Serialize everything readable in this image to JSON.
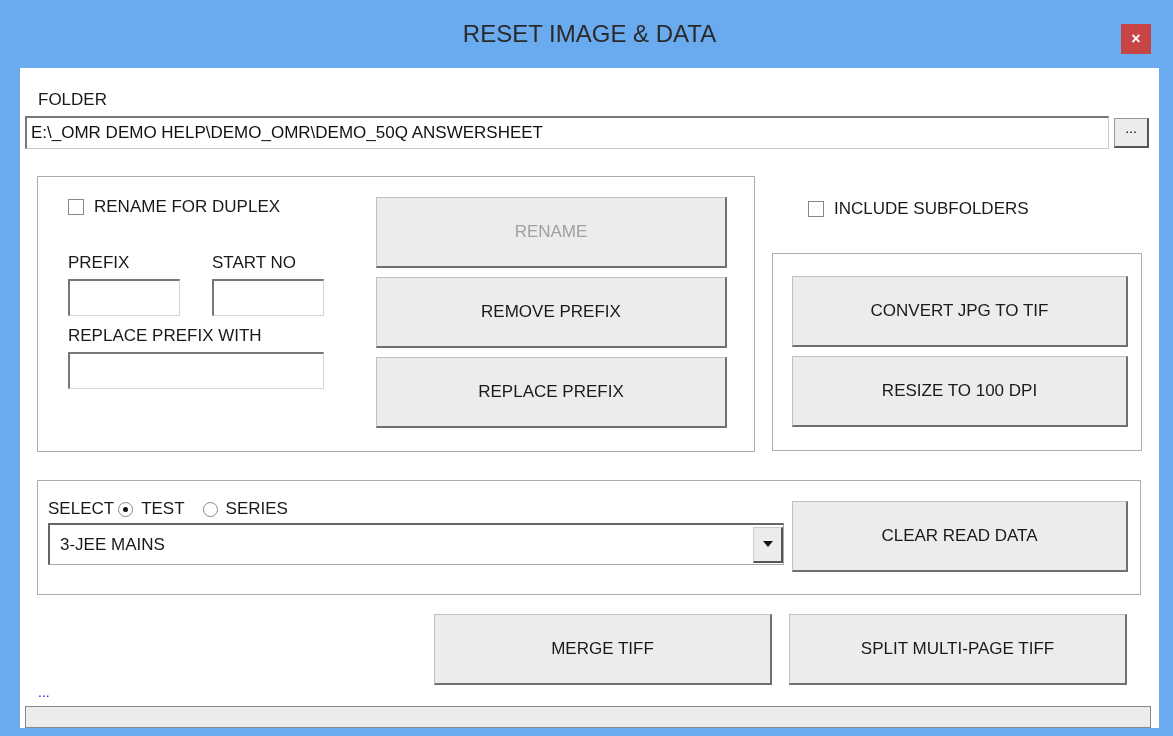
{
  "window": {
    "title": "RESET IMAGE & DATA",
    "close": "×"
  },
  "folder": {
    "label": "FOLDER",
    "value": "E:\\_OMR DEMO HELP\\DEMO_OMR\\DEMO_50Q ANSWERSHEET",
    "browse": "..."
  },
  "rename": {
    "duplex": {
      "label": "RENAME FOR DUPLEX",
      "checked": false
    },
    "prefix": {
      "label": "PREFIX"
    },
    "start_no": {
      "label": "START NO"
    },
    "replace_with": {
      "label": "REPLACE PREFIX WITH"
    },
    "buttons": [
      {
        "label": "RENAME",
        "disabled": true
      },
      {
        "label": "REMOVE PREFIX",
        "disabled": false
      },
      {
        "label": "REPLACE PREFIX",
        "disabled": false
      }
    ]
  },
  "include_subfolders": {
    "label": "INCLUDE SUBFOLDERS",
    "checked": false
  },
  "convert_buttons": [
    {
      "label": "CONVERT JPG TO TIF"
    },
    {
      "label": "RESIZE TO 100 DPI"
    }
  ],
  "select": {
    "label": "SELECT",
    "options": [
      {
        "label": "TEST",
        "selected": true
      },
      {
        "label": "SERIES",
        "selected": false
      }
    ],
    "dropdown": {
      "value": "3-JEE MAINS"
    },
    "button": "CLEAR READ DATA"
  },
  "tiff_buttons": [
    {
      "label": "MERGE TIFF"
    },
    {
      "label": "SPLIT MULTI-PAGE TIFF"
    }
  ],
  "status": {
    "text": "..."
  }
}
